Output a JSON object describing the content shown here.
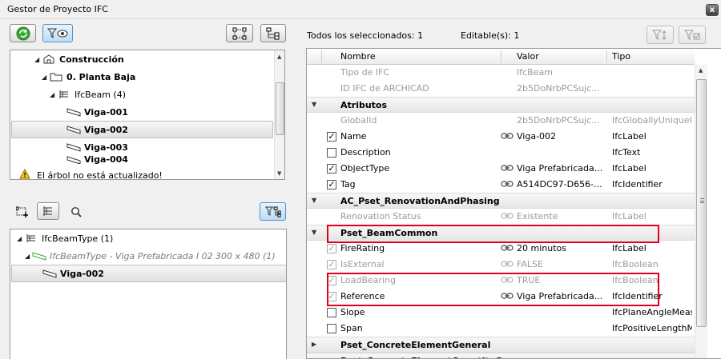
{
  "window": {
    "title": "Gestor de Proyecto IFC",
    "close_label": "x"
  },
  "left": {
    "tree_top": [
      {
        "label": "Construcción",
        "icon": "building-icon",
        "expanded": true
      },
      {
        "label": "0. Planta Baja",
        "icon": "folder-icon",
        "expanded": true
      },
      {
        "label": "IfcBeam (4)",
        "icon": "list-icon",
        "expanded": true
      },
      {
        "label": "Viga-001",
        "icon": "beam-icon"
      },
      {
        "label": "Viga-002",
        "icon": "beam-icon",
        "selected": true
      },
      {
        "label": "Viga-003",
        "icon": "beam-icon"
      },
      {
        "label": "Viga-004",
        "icon": "beam-icon"
      }
    ],
    "warning": "El árbol no está actualizado!",
    "tree_bottom": [
      {
        "label": "IfcBeamType (1)",
        "icon": "list-icon"
      },
      {
        "label": "IfcBeamType - Viga Prefabricada I 02 300 x 480 (1)",
        "icon": "beam-type-icon"
      },
      {
        "label": "Viga-002",
        "icon": "beam-icon",
        "selected": true
      }
    ]
  },
  "right": {
    "selected_label": "Todos los seleccionados: 1",
    "editable_label": "Editable(s): 1",
    "columns": {
      "name": "Nombre",
      "value": "Valor",
      "type": "Tipo"
    },
    "rows": [
      {
        "kind": "prop",
        "name": "Tipo de IFC",
        "value": "IfcBeam",
        "type": "",
        "grey": true,
        "check": "none"
      },
      {
        "kind": "prop",
        "name": "ID IFC de ARCHICAD",
        "value": "2b5DoNrbPCSujc...",
        "type": "",
        "grey": true,
        "check": "none"
      },
      {
        "kind": "section",
        "name": "Atributos",
        "expanded": true
      },
      {
        "kind": "prop",
        "name": "GlobalId",
        "value": "2b5DoNrbPCSujc...",
        "type": "IfcGloballyUniqueId",
        "grey": true,
        "check": "none"
      },
      {
        "kind": "prop",
        "name": "Name",
        "value": "Viga-002",
        "type": "IfcLabel",
        "check": "on",
        "link": true
      },
      {
        "kind": "prop",
        "name": "Description",
        "value": "",
        "type": "IfcText",
        "check": "off"
      },
      {
        "kind": "prop",
        "name": "ObjectType",
        "value": "Viga Prefabricada...",
        "type": "IfcLabel",
        "check": "on",
        "link": true
      },
      {
        "kind": "prop",
        "name": "Tag",
        "value": "A514DC97-D656-...",
        "type": "IfcIdentifier",
        "check": "on",
        "link": true
      },
      {
        "kind": "section",
        "name": "AC_Pset_RenovationAndPhasing",
        "expanded": true
      },
      {
        "kind": "prop",
        "name": "Renovation Status",
        "value": "Existente",
        "type": "IfcLabel",
        "grey": true,
        "check": "none",
        "link": true
      },
      {
        "kind": "section",
        "name": "Pset_BeamCommon",
        "expanded": true
      },
      {
        "kind": "prop",
        "name": "FireRating",
        "value": "20 minutos",
        "type": "IfcLabel",
        "check": "grey",
        "link": true
      },
      {
        "kind": "prop",
        "name": "IsExternal",
        "value": "FALSE",
        "type": "IfcBoolean",
        "grey": true,
        "check": "grey",
        "link": true
      },
      {
        "kind": "prop",
        "name": "LoadBearing",
        "value": "TRUE",
        "type": "IfcBoolean",
        "grey": true,
        "check": "grey",
        "link": true
      },
      {
        "kind": "prop",
        "name": "Reference",
        "value": "Viga Prefabricada...",
        "type": "IfcIdentifier",
        "check": "grey",
        "link": true
      },
      {
        "kind": "prop",
        "name": "Slope",
        "value": "",
        "type": "IfcPlaneAngleMeasure",
        "check": "off"
      },
      {
        "kind": "prop",
        "name": "Span",
        "value": "",
        "type": "IfcPositiveLengthMeasure",
        "check": "off"
      },
      {
        "kind": "section",
        "name": "Pset_ConcreteElementGeneral",
        "expanded": false
      },
      {
        "kind": "section",
        "name": "Pset_ConcreteElementQuantityGene...",
        "expanded": false
      }
    ]
  },
  "colors": {
    "highlight": "#e0001b",
    "refresh_green": "#3aa335",
    "filter_active": "#bcdcf4"
  }
}
